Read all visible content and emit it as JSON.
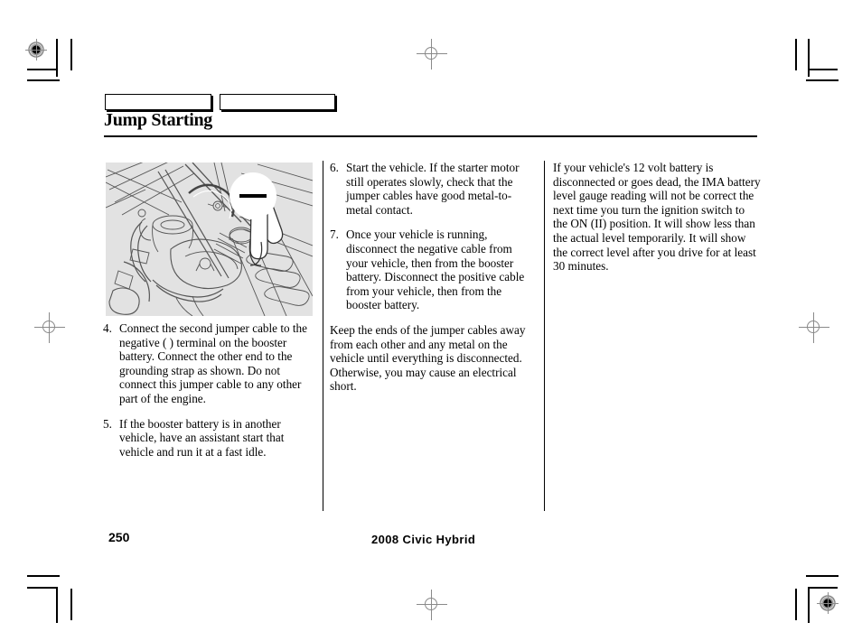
{
  "document": {
    "title": "Jump Starting",
    "page_number": "250",
    "footer": "2008  Civic  Hybrid"
  },
  "tabs": [
    {
      "label": "",
      "name": "tab-box-left"
    },
    {
      "label": "",
      "name": "tab-box-right"
    }
  ],
  "figure": {
    "caption": "",
    "badge_symbol": "—",
    "badge_meaning": "negative-terminal-marker",
    "background_color": "#e2e2e2",
    "description": "Engine compartment line drawing showing jumper cable clamp attached to grounding strap"
  },
  "columns": {
    "left": {
      "items": [
        {
          "number": "4.",
          "text": "Connect the second jumper cable to the negative (  ) terminal on the booster battery. Connect the other end to the grounding strap as shown. Do not connect this jumper cable to any other part of the engine."
        },
        {
          "number": "5.",
          "text": "If the booster battery is in another vehicle, have an assistant start that vehicle and run it at a fast idle."
        }
      ]
    },
    "middle": {
      "items": [
        {
          "number": "6.",
          "text": "Start the vehicle. If the starter motor still operates slowly, check that the jumper cables have good metal-to-metal contact."
        },
        {
          "number": "7.",
          "text": "Once your vehicle is running, disconnect the negative cable from your vehicle, then from the booster battery. Disconnect the positive cable from your vehicle, then from the booster battery."
        }
      ],
      "paragraphs": [
        "Keep the ends of the jumper cables away from each other and any metal on the vehicle until everything is disconnected. Otherwise, you may cause an electrical short."
      ]
    },
    "right": {
      "paragraphs": [
        "If your vehicle's 12 volt battery is disconnected or goes dead, the IMA battery level gauge reading will not be correct the next time you turn the ignition switch to the ON (II) position. It will show less than the actual level temporarily. It will show the correct level after you drive for at least 30 minutes."
      ]
    }
  },
  "print_marks": {
    "bullseye_positions": [
      "top-left",
      "bottom-right"
    ],
    "crosshair_positions": [
      "top-center",
      "bottom-center",
      "left-middle",
      "right-middle"
    ],
    "crop_corners": [
      "top-left",
      "top-right",
      "bottom-left",
      "bottom-right"
    ]
  }
}
